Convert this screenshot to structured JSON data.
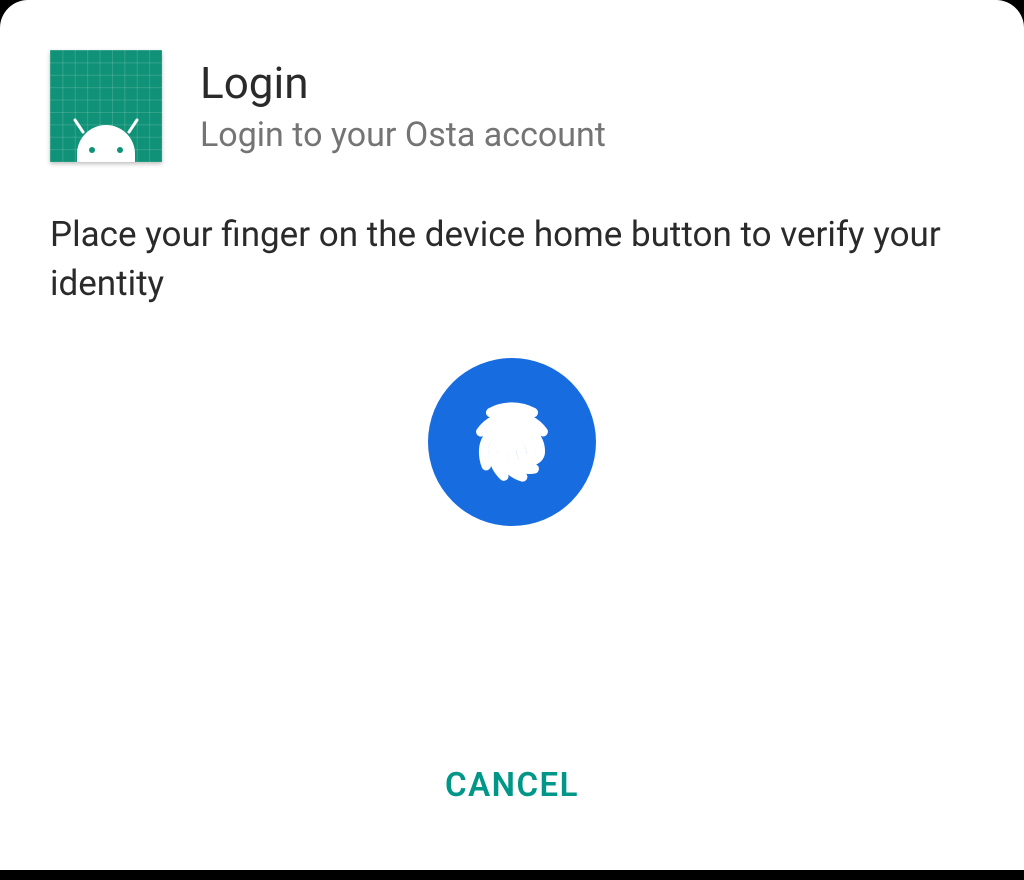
{
  "dialog": {
    "title": "Login",
    "subtitle": "Login to your Osta account",
    "instruction": "Place your finger on the device home button to verify your identity",
    "cancel_label": "CANCEL"
  }
}
